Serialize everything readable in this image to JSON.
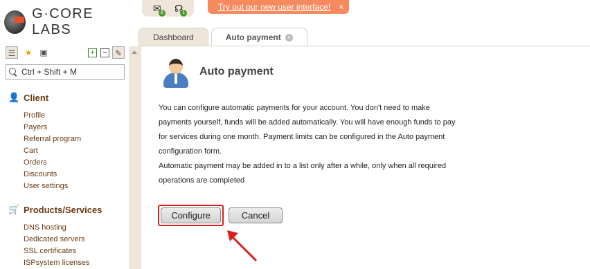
{
  "brand": {
    "name": "G·CORE LABS"
  },
  "top_icons": [
    {
      "icon": "envelope-icon",
      "badge": "8"
    },
    {
      "icon": "headset-icon",
      "badge": "1"
    }
  ],
  "promo": {
    "link": "Try out our new user interface!",
    "close": "×"
  },
  "tabs": [
    {
      "label": "Dashboard",
      "active": false
    },
    {
      "label": "Auto payment",
      "active": true,
      "close": "×"
    }
  ],
  "search": {
    "placeholder": "Ctrl + Shift + M"
  },
  "sidebar": {
    "sections": [
      {
        "title": "Client",
        "icon": "user-icon",
        "items": [
          "Profile",
          "Payers",
          "Referral program",
          "Cart",
          "Orders",
          "Discounts",
          "User settings"
        ]
      },
      {
        "title": "Products/Services",
        "icon": "cart-icon",
        "items": [
          "DNS hosting",
          "Dedicated servers",
          "SSL certificates",
          "ISPsystem licenses"
        ]
      }
    ]
  },
  "main": {
    "title": "Auto payment",
    "description": [
      "You can configure automatic payments for your account. You don't need to make",
      "payments yourself, funds will be added automatically. You will have enough funds to pay",
      "for services during one month. Payment limits can be configured in the Auto payment",
      "configuration form.",
      "Automatic payment may be added in to a list only after a while, only when all required",
      "operations are completed"
    ],
    "buttons": {
      "configure": "Configure",
      "cancel": "Cancel"
    }
  },
  "colors": {
    "accent": "#f58a5f",
    "sidebar_link": "#6a3a14",
    "highlight": "#e01b1b",
    "tab_bg": "#efe6db"
  }
}
